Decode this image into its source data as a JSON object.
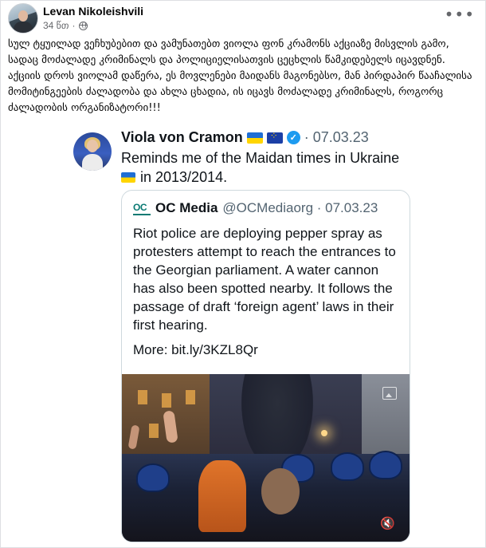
{
  "post": {
    "author": "Levan Nikoleishvili",
    "time": "34 წთ",
    "audience_icon": "globe-icon",
    "more_icon": "more-options-icon",
    "more_glyph": "•••",
    "caption": "სულ ტყუილად ვეჩხუბებით და ვამუნათებთ ვიოლა ფონ კრამონს აქციაზე მისვლის გამო, სადაც მოძალადე კრიმინალს და პოლიციელისათვის ცეცხლის წამკიდებელს იცავდნენ. აქციის დროს ვიოლამ დაწერა, ეს მოვლენები მაიდანს მაგონებსო, მან პირდაპირ წააჩალისა მომიტინგეების ძალადობა და ახლა ცხადია, ის იცავს მოძალადე კრიმინალს, როგორც ძალადობის ორგანიზატორი!!!"
  },
  "tweet": {
    "name": "Viola von Cramon",
    "date": "· 07.03.23",
    "verified_glyph": "✓",
    "text_line1": "Reminds me of the Maidan times in Ukraine",
    "text_line2": "in 2013/2014.",
    "quote": {
      "logo": "OC",
      "name": "OC Media",
      "handle": "@OCMediaorg · 07.03.23",
      "text": "Riot police are deploying pepper spray as protesters attempt to reach the entrances to the Georgian parliament. A water cannon has also been spotted nearby. It follows the passage of draft ‘foreign agent’ laws in their first hearing.",
      "link": "More: bit.ly/3KZL8Qr",
      "mute_glyph": "🔇"
    }
  },
  "colors": {
    "secondary_text": "#65676b",
    "twitter_blue": "#1d9bf0",
    "oc_teal": "#0a7a73"
  }
}
